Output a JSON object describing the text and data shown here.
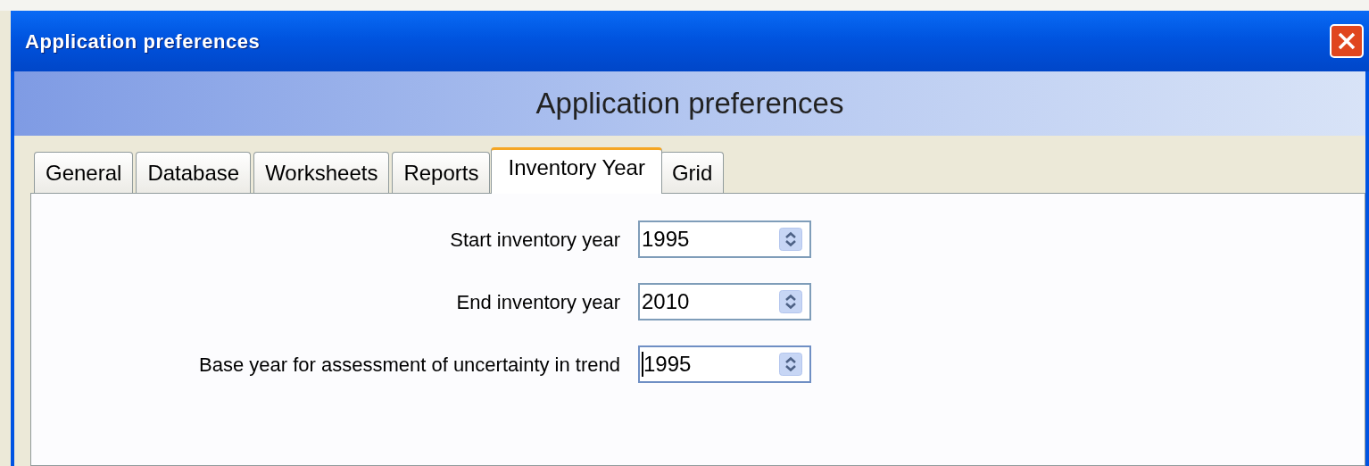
{
  "window": {
    "title": "Application preferences"
  },
  "header": {
    "title": "Application preferences"
  },
  "tabs": [
    {
      "label": "General",
      "selected": false
    },
    {
      "label": "Database",
      "selected": false
    },
    {
      "label": "Worksheets",
      "selected": false
    },
    {
      "label": "Reports",
      "selected": false
    },
    {
      "label": "Inventory Year",
      "selected": true
    },
    {
      "label": "Grid",
      "selected": false
    }
  ],
  "fields": [
    {
      "label": "Start inventory year",
      "value": "1995",
      "focused": false
    },
    {
      "label": "End inventory year",
      "value": "2010",
      "focused": false
    },
    {
      "label": "Base year for assessment of uncertainty in trend",
      "value": "1995",
      "focused": true
    }
  ]
}
